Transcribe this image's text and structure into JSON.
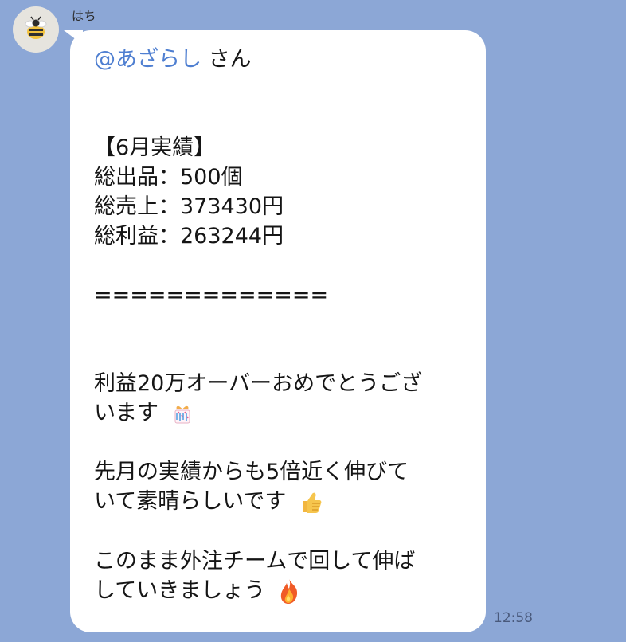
{
  "chat": {
    "sender_name": "はち",
    "message": {
      "mention": "@あざらし",
      "mention_suffix": " さん",
      "lines": {
        "title": "【6月実績】",
        "items": [
          "総出品：500個",
          "総売上：373430円",
          "総利益：263244円"
        ],
        "divider": "=============",
        "congrats_line_1": "利益20万オーバーおめでとうござ",
        "congrats_line_2": "います",
        "growth_line_1": "先月の実績からも5倍近く伸びて",
        "growth_line_2": "いて素晴らしいです",
        "closing_line_1": "このまま外注チームで回して伸ば",
        "closing_line_2": "していきましょう"
      },
      "icons": {
        "gift": "gift-confetti-icon",
        "thumbs_up": "thumbs-up-icon",
        "fire": "fire-icon"
      }
    },
    "timestamp": "12:58",
    "colors": {
      "background": "#8ca7d6",
      "bubble": "#ffffff",
      "mention": "#4f7fd1",
      "text": "#151515",
      "timestamp": "#49597b"
    }
  }
}
